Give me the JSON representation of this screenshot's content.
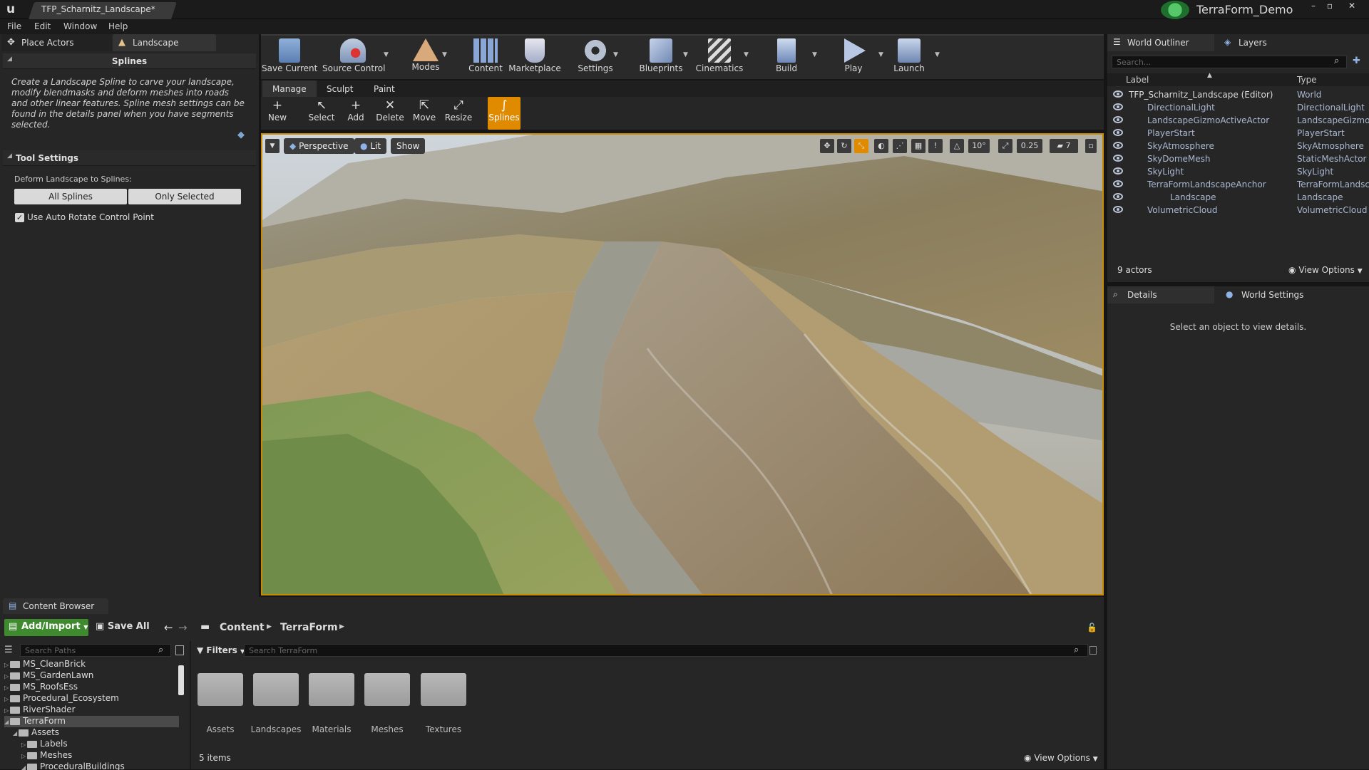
{
  "window": {
    "doc_tab": "TFP_Scharnitz_Landscape*",
    "app_title": "TerraForm_Demo",
    "controls": [
      "–",
      "▫",
      "✕"
    ]
  },
  "menu": [
    "File",
    "Edit",
    "Window",
    "Help"
  ],
  "left_panel": {
    "tabs": [
      "Place Actors",
      "Landscape"
    ],
    "splines_title": "Splines",
    "splines_desc": "Create a Landscape Spline to carve your landscape, modify blendmasks and deform meshes into roads and other linear features. Spline mesh settings can be found in the details panel when you have  segments selected.",
    "tool_settings_title": "Tool Settings",
    "deform_label": "Deform Landscape to Splines:",
    "all_splines": "All Splines",
    "only_selected": "Only Selected",
    "auto_rotate": "Use Auto Rotate Control Point"
  },
  "toolbar": {
    "items": [
      "Save Current",
      "Source Control",
      "Modes",
      "Content",
      "Marketplace",
      "Settings",
      "Blueprints",
      "Cinematics",
      "Build",
      "Play",
      "Launch"
    ]
  },
  "mode_tabs": [
    "Manage",
    "Sculpt",
    "Paint"
  ],
  "landscape_tools": [
    "New",
    "Select",
    "Add",
    "Delete",
    "Move",
    "Resize",
    "Splines"
  ],
  "viewport": {
    "perspective": "Perspective",
    "lit": "Lit",
    "show": "Show",
    "rotation_snap": "10°",
    "scale_snap": "0.25",
    "camera_speed": "7"
  },
  "outliner": {
    "tabs": [
      "World Outliner",
      "Layers"
    ],
    "search_placeholder": "Search...",
    "col_label": "Label",
    "col_type": "Type",
    "rows": [
      {
        "label": "TFP_Scharnitz_Landscape (Editor)",
        "type": "World"
      },
      {
        "label": "DirectionalLight",
        "type": "DirectionalLight"
      },
      {
        "label": "LandscapeGizmoActiveActor",
        "type": "LandscapeGizmo"
      },
      {
        "label": "PlayerStart",
        "type": "PlayerStart"
      },
      {
        "label": "SkyAtmosphere",
        "type": "SkyAtmosphere"
      },
      {
        "label": "SkyDomeMesh",
        "type": "StaticMeshActor"
      },
      {
        "label": "SkyLight",
        "type": "SkyLight"
      },
      {
        "label": "TerraFormLandscapeAnchor",
        "type": "TerraFormLandsc"
      },
      {
        "label": "Landscape",
        "type": "Landscape"
      },
      {
        "label": "VolumetricCloud",
        "type": "VolumetricCloud"
      }
    ],
    "count": "9 actors",
    "view_options": "View Options"
  },
  "details": {
    "tabs": [
      "Details",
      "World Settings"
    ],
    "empty": "Select an object to view details."
  },
  "content_browser": {
    "tab": "Content Browser",
    "add_import": "Add/Import",
    "save_all": "Save All",
    "path": [
      "Content",
      "TerraForm"
    ],
    "search_paths": "Search Paths",
    "filters": "Filters",
    "search_placeholder": "Search TerraForm",
    "tree": [
      "MS_CleanBrick",
      "MS_GardenLawn",
      "MS_RoofsEss",
      "Procedural_Ecosystem",
      "RiverShader",
      "TerraForm",
      "Assets",
      "Labels",
      "Meshes",
      "ProceduralBuildings"
    ],
    "folders": [
      "Assets",
      "Landscapes",
      "Materials",
      "Meshes",
      "Textures"
    ],
    "items_count": "5 items",
    "view_options": "View Options"
  }
}
